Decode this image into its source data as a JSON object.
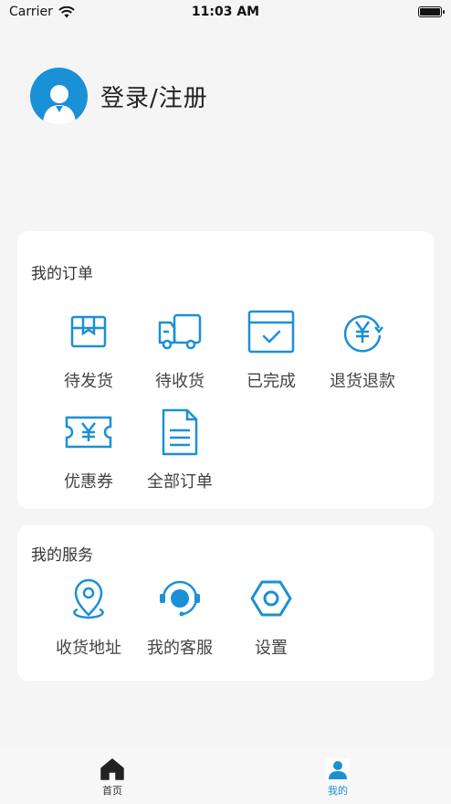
{
  "status_bar": {
    "carrier": "Carrier",
    "time": "11:03 AM"
  },
  "profile": {
    "login_label": "登录/注册"
  },
  "orders": {
    "title": "我的订单",
    "items": [
      {
        "label": "待发货",
        "icon": "package-icon"
      },
      {
        "label": "待收货",
        "icon": "truck-icon"
      },
      {
        "label": "已完成",
        "icon": "check-box-icon"
      },
      {
        "label": "退货退款",
        "icon": "yen-refund-icon"
      },
      {
        "label": "优惠券",
        "icon": "coupon-icon"
      },
      {
        "label": "全部订单",
        "icon": "document-icon"
      }
    ]
  },
  "services": {
    "title": "我的服务",
    "items": [
      {
        "label": "收货地址",
        "icon": "location-pin-icon"
      },
      {
        "label": "我的客服",
        "icon": "headset-icon"
      },
      {
        "label": "设置",
        "icon": "hex-settings-icon"
      }
    ]
  },
  "tabbar": {
    "tabs": [
      {
        "label": "首页",
        "icon": "home-icon",
        "active": false
      },
      {
        "label": "我的",
        "icon": "user-icon",
        "active": true
      }
    ]
  },
  "colors": {
    "accent": "#1a90d6",
    "background": "#f5f5f5",
    "card": "#ffffff"
  }
}
